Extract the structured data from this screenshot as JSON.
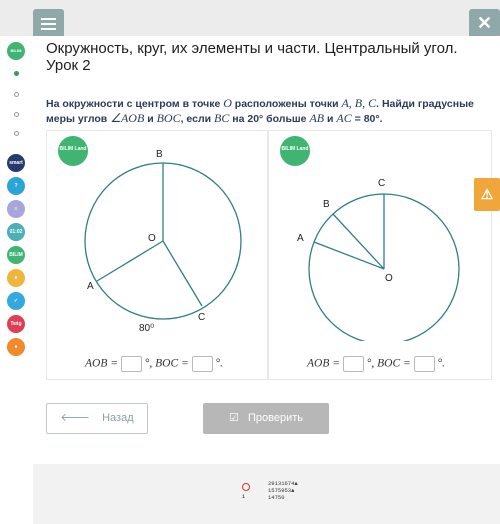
{
  "header": {
    "title": "Окружность, круг, их элементы и части. Центральный угол. Урок 2"
  },
  "nav_apps": [
    {
      "label": "smart",
      "color": "#273a6e"
    },
    {
      "label": "?",
      "color": "#2aa5d8"
    },
    {
      "label": "≡",
      "color": "#a6a6d8"
    },
    {
      "label": "01:02",
      "color": "#4ab0b5"
    },
    {
      "label": "BILIM",
      "color": "#3fb571"
    },
    {
      "label": "e",
      "color": "#f0b63b"
    },
    {
      "label": "✓",
      "color": "#33a9dd"
    },
    {
      "label": "Twig",
      "color": "#dd3f55"
    },
    {
      "label": "●",
      "color": "#f08a2b"
    }
  ],
  "task": {
    "part1": "На окружности с центром в точке ",
    "O": "O",
    "part2": " расположены точки ",
    "points": "A, B, C",
    "part3": ". Найди градусные меры углов ",
    "angle_aob": "∠AOB",
    "part4": " и ",
    "boc": "BOC",
    "part5": ", если ",
    "bc": "BC",
    "part6": " на 20° больше ",
    "ab": "AB",
    "part7": " и ",
    "ac": "AC",
    "part8": " = 80°."
  },
  "figure_left": {
    "logo": "BILIM Land",
    "label_B": "B",
    "label_O": "O",
    "label_A": "A",
    "label_C": "C",
    "arc_value": "80⁰"
  },
  "figure_right": {
    "logo": "BILIM Land",
    "label_C": "C",
    "label_B": "B",
    "label_A": "A",
    "label_O": "O"
  },
  "answers": {
    "aob_label": "AOB = ",
    "deg1": " °, ",
    "boc_label": "BOC = ",
    "deg2": " °."
  },
  "buttons": {
    "back": "Назад",
    "check": "Проверить"
  },
  "counter": {
    "line1": "29131674▲",
    "line2": "1575953▲",
    "line3": "14750",
    "one": "1"
  },
  "colors": {
    "accent_teal": "#2f7f86",
    "warning": "#f0a63b",
    "menu_btn": "#8fa8a9"
  },
  "icons": {
    "menu": "menu-icon",
    "close": "close-icon",
    "warning": "warning-icon",
    "back_arrow": "arrow-left-icon",
    "check": "check-icon"
  }
}
